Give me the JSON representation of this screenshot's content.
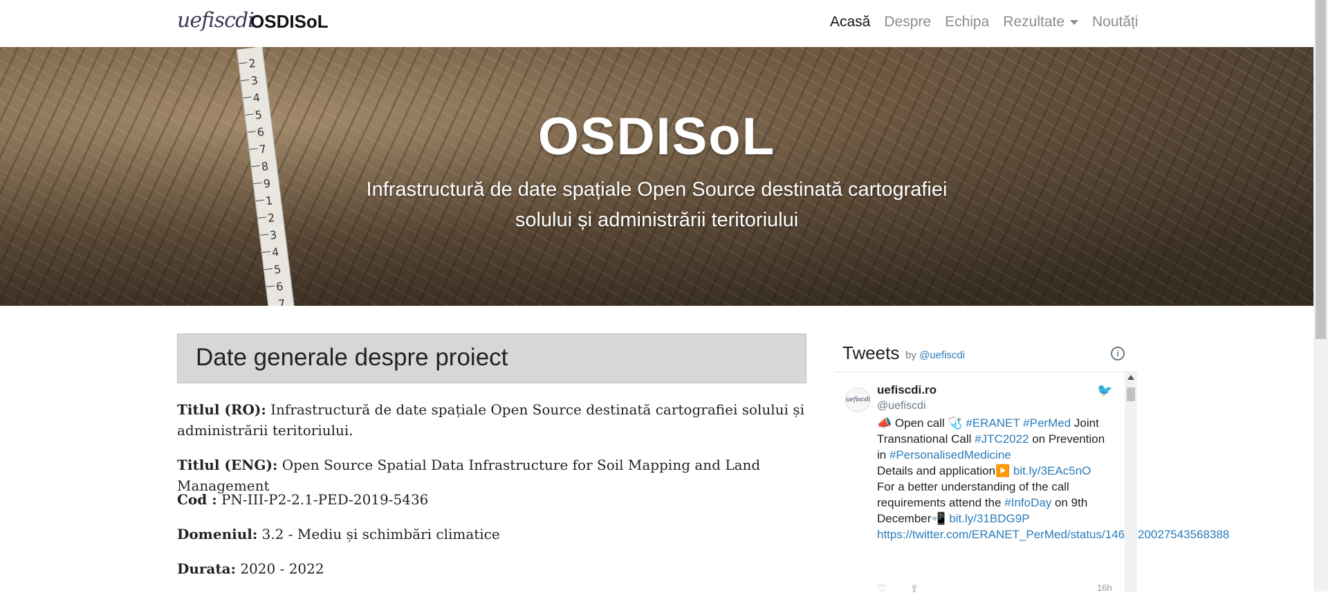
{
  "nav": {
    "logo_text": "uefiscdi",
    "brand": "OSDISoL",
    "items": [
      {
        "label": "Acasă",
        "active": true
      },
      {
        "label": "Despre",
        "active": false
      },
      {
        "label": "Echipa",
        "active": false
      },
      {
        "label": "Rezultate",
        "active": false,
        "dropdown": true
      },
      {
        "label": "Noutăți",
        "active": false
      }
    ]
  },
  "hero": {
    "title": "OSDISoL",
    "subtitle": "Infrastructură de date spațiale Open Source destinată cartografiei solului și administrării teritoriului",
    "ruler_numbers": "2 3 4 5 6 7 8 9 1 2 3 4 5 6 7"
  },
  "main": {
    "section_title": "Date generale despre proiect",
    "fields": [
      {
        "label": "Titlul (RO):",
        "value": "Infrastructură de date spațiale Open Source destinată cartografiei solului și administrării teritoriului."
      },
      {
        "label": "Titlul (ENG):",
        "value": "Open Source Spatial Data Infrastructure for Soil Mapping and Land Management"
      },
      {
        "label": "Cod :",
        "value": "PN-III-P2-2.1-PED-2019-5436"
      },
      {
        "label": "Domeniul:",
        "value": "3.2 - Mediu și schimbări climatice"
      },
      {
        "label": "Durata:",
        "value": "2020 - 2022"
      }
    ]
  },
  "tweets": {
    "title": "Tweets",
    "by": "by",
    "by_handle": "@uefiscdi",
    "info_icon": "info-icon",
    "tweet": {
      "avatar_text": "uefiscdi",
      "name": "uefiscdi.ro",
      "handle": "@uefiscdi",
      "time": "16h",
      "lines": [
        {
          "t": "📣 Open call 🩺 "
        },
        {
          "l": "#ERANET"
        },
        {
          "t": " "
        },
        {
          "l": "#PerMed"
        },
        {
          "t": " Joint Transnational Call "
        },
        {
          "l": "#JTC2022"
        },
        {
          "t": " on Prevention in "
        },
        {
          "l": "#PersonalisedMedicine"
        },
        {
          "br": true
        },
        {
          "t": "Details and application▶️ "
        },
        {
          "l": "bit.ly/3EAc5nO"
        },
        {
          "br": true
        },
        {
          "t": "For a better understanding of the call requirements attend the "
        },
        {
          "l": "#InfoDay"
        },
        {
          "t": " on 9th December📲 "
        },
        {
          "l": "bit.ly/31BDG9P"
        },
        {
          "br": true
        },
        {
          "l": "https://twitter.com/ERANET_PerMed/status/1466020027543568388"
        }
      ]
    }
  }
}
